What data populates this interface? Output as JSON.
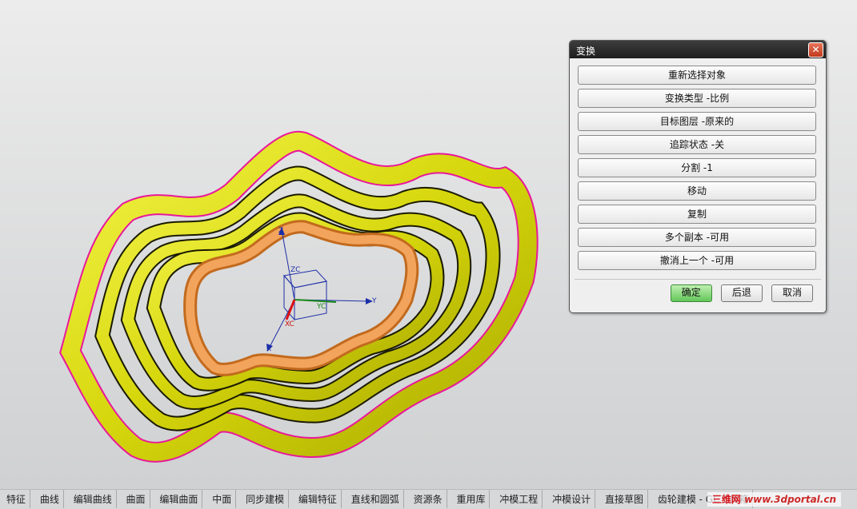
{
  "dialog": {
    "title": "变换",
    "close_icon": "close-icon",
    "options": [
      "重新选择对象",
      "变换类型 -比例",
      "目标图层 -原来的",
      "追踪状态 -关",
      "分割 -1",
      "移动",
      "复制",
      "多个副本 -可用",
      "撤消上一个 -可用"
    ],
    "ok_label": "确定",
    "back_label": "后退",
    "cancel_label": "取消",
    "ok_color": "#62c659"
  },
  "triad": {
    "z": "Z",
    "zc": "ZC",
    "y": "Y",
    "yc": "YC",
    "xc": "XC",
    "x": "X"
  },
  "tabs": [
    "特征",
    "曲线",
    "编辑曲线",
    "曲面",
    "编辑曲面",
    "中面",
    "同步建模",
    "编辑特征",
    "直线和圆弧",
    "资源条",
    "重用库",
    "冲模工程",
    "冲模设计",
    "直接草图",
    "齿轮建模 - GC工具箱"
  ],
  "watermark": {
    "cn": "三维网",
    "url": "www.3dportal.cn"
  },
  "colors": {
    "ring_yellow": "#dede10",
    "ring_edge": "#e8189a",
    "selected_ring": "#f09a52"
  }
}
